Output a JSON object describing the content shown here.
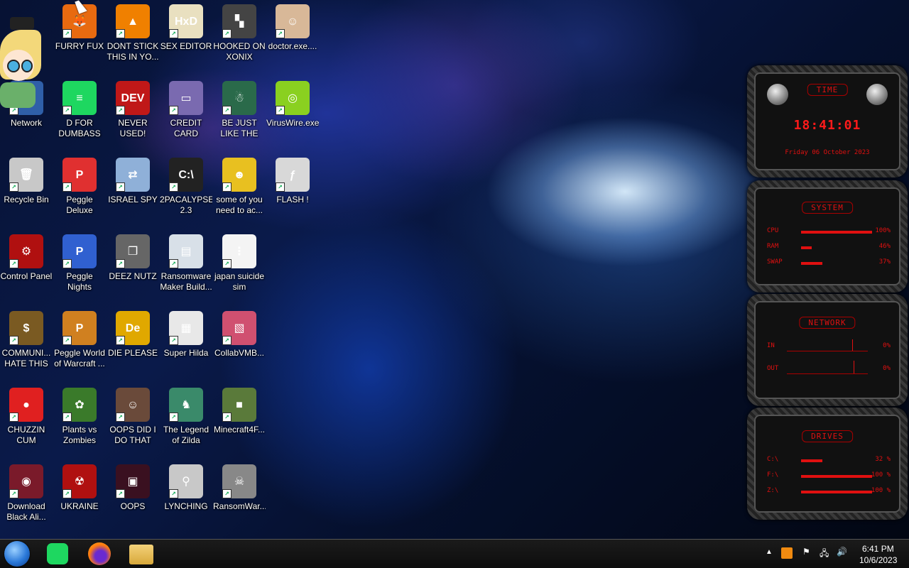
{
  "icons": [
    {
      "label": "Network",
      "col": 0,
      "row": 1,
      "color": "#2f5fa8",
      "glyph": "🖧"
    },
    {
      "label": "Recycle Bin",
      "col": 0,
      "row": 2,
      "color": "#c8c8c8",
      "glyph": "🗑"
    },
    {
      "label": "Control Panel",
      "col": 0,
      "row": 3,
      "color": "#b01010",
      "glyph": "⚙"
    },
    {
      "label": "COMMUNI... HATE THIS ...",
      "col": 0,
      "row": 4,
      "color": "#7a5a22",
      "glyph": "$"
    },
    {
      "label": "CHUZZIN CUM",
      "col": 0,
      "row": 5,
      "color": "#e02020",
      "glyph": "●"
    },
    {
      "label": "Download Black Ali...",
      "col": 0,
      "row": 6,
      "color": "#7a1a2a",
      "glyph": "◉"
    },
    {
      "label": "FURRY FUX",
      "col": 1,
      "row": 0,
      "color": "#e86a10",
      "glyph": "🦊"
    },
    {
      "label": "D FOR DUMBASS",
      "col": 1,
      "row": 1,
      "color": "#1ed760",
      "glyph": "≡"
    },
    {
      "label": "Peggle Deluxe",
      "col": 1,
      "row": 2,
      "color": "#e03030",
      "glyph": "P"
    },
    {
      "label": "Peggle Nights Deluxe",
      "col": 1,
      "row": 3,
      "color": "#3060d0",
      "glyph": "P"
    },
    {
      "label": "Peggle World of Warcraft ...",
      "col": 1,
      "row": 4,
      "color": "#d08020",
      "glyph": "P"
    },
    {
      "label": "Plants vs Zombies",
      "col": 1,
      "row": 5,
      "color": "#3a7a2a",
      "glyph": "✿"
    },
    {
      "label": "UKRAINE",
      "col": 1,
      "row": 6,
      "color": "#b01010",
      "glyph": "☢"
    },
    {
      "label": "DONT STICK THIS IN YO...",
      "col": 2,
      "row": 0,
      "color": "#f08000",
      "glyph": "▲"
    },
    {
      "label": "NEVER USED!",
      "col": 2,
      "row": 1,
      "color": "#c01818",
      "glyph": "DEV"
    },
    {
      "label": "ISRAEL SPY",
      "col": 2,
      "row": 2,
      "color": "#8fb0d8",
      "glyph": "⇄"
    },
    {
      "label": "DEEZ NUTZ",
      "col": 2,
      "row": 3,
      "color": "#666",
      "glyph": "❐"
    },
    {
      "label": "DIE PLEASE",
      "col": 2,
      "row": 4,
      "color": "#e0a800",
      "glyph": "De"
    },
    {
      "label": "OOPS DID I DO THAT",
      "col": 2,
      "row": 5,
      "color": "#6a4a3a",
      "glyph": "☺"
    },
    {
      "label": "OOPS",
      "col": 2,
      "row": 6,
      "color": "#3a1020",
      "glyph": "▣"
    },
    {
      "label": "SEX EDITOR",
      "col": 3,
      "row": 0,
      "color": "#e9e0c0",
      "glyph": "HxD"
    },
    {
      "label": "CREDIT CARD CHECKER",
      "col": 3,
      "row": 1,
      "color": "#7a6ab0",
      "glyph": "▭"
    },
    {
      "label": "2PACALYPSE 2.3",
      "col": 3,
      "row": 2,
      "color": "#222",
      "glyph": "C:\\"
    },
    {
      "label": "Ransomware Maker Build...",
      "col": 3,
      "row": 3,
      "color": "#d8e0e8",
      "glyph": "▤"
    },
    {
      "label": "Super Hilda",
      "col": 3,
      "row": 4,
      "color": "#e8e8e8",
      "glyph": "▦"
    },
    {
      "label": "The Legend of Zilda",
      "col": 3,
      "row": 5,
      "color": "#3a8a6a",
      "glyph": "♞"
    },
    {
      "label": "LYNCHING",
      "col": 3,
      "row": 6,
      "color": "#c8c8c8",
      "glyph": "⚲"
    },
    {
      "label": "HOOKED ON XONIX",
      "col": 4,
      "row": 0,
      "color": "#444",
      "glyph": "▚"
    },
    {
      "label": "BE JUST LIKE THE DUDE!",
      "col": 4,
      "row": 1,
      "color": "#2a6a4a",
      "glyph": "☃"
    },
    {
      "label": "some of you need to ac...",
      "col": 4,
      "row": 2,
      "color": "#e8c020",
      "glyph": "☻"
    },
    {
      "label": "japan suicide sim",
      "col": 4,
      "row": 3,
      "color": "#f4f4f4",
      "glyph": "⋮"
    },
    {
      "label": "CollabVMB...",
      "col": 4,
      "row": 4,
      "color": "#d05070",
      "glyph": "▧"
    },
    {
      "label": "Minecraft4F...",
      "col": 4,
      "row": 5,
      "color": "#5a7a3a",
      "glyph": "■"
    },
    {
      "label": "RansomWar...",
      "col": 4,
      "row": 6,
      "color": "#888",
      "glyph": "☠"
    },
    {
      "label": "doctor.exe....",
      "col": 5,
      "row": 0,
      "color": "#d8b898",
      "glyph": "☺"
    },
    {
      "label": "VirusWire.exe",
      "col": 5,
      "row": 1,
      "color": "#8ad020",
      "glyph": "◎"
    },
    {
      "label": "FLASH !",
      "col": 5,
      "row": 2,
      "color": "#d8d8d8",
      "glyph": "ƒ"
    }
  ],
  "widgets": {
    "time": {
      "title": "TIME",
      "clock": "18:41:01",
      "date": "Friday 06 October 2023"
    },
    "system": {
      "title": "SYSTEM",
      "rows": [
        {
          "key": "CPU",
          "value": "100%",
          "fill": 1.0
        },
        {
          "key": "RAM",
          "value": "46%",
          "fill": 0.15
        },
        {
          "key": "SWAP",
          "value": "37%",
          "fill": 0.3
        }
      ]
    },
    "network": {
      "title": "NETWORK",
      "rows": [
        {
          "key": "IN",
          "value": "0%"
        },
        {
          "key": "OUT",
          "value": "0%"
        }
      ]
    },
    "drives": {
      "title": "DRIVES",
      "rows": [
        {
          "key": "C:\\",
          "value": "32 %",
          "fill": 0.3
        },
        {
          "key": "F:\\",
          "value": "100 %",
          "fill": 1.0
        },
        {
          "key": "Z:\\",
          "value": "100 %",
          "fill": 1.0
        }
      ]
    }
  },
  "taskbar": {
    "clock_time": "6:41 PM",
    "clock_date": "10/6/2023",
    "apps": [
      "start-orb",
      "spotify-icon",
      "firefox-icon",
      "file-explorer-icon"
    ]
  }
}
